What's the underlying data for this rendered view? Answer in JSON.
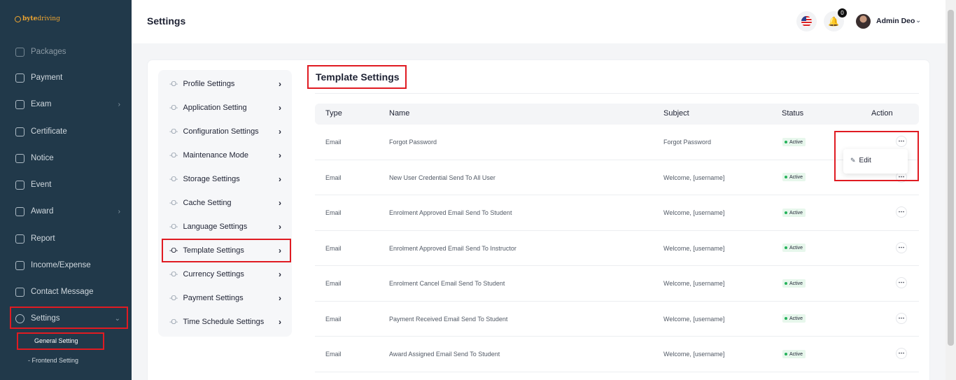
{
  "brand": {
    "part1": "byte",
    "part2": "driving"
  },
  "header": {
    "title": "Settings",
    "notification_count": "0",
    "user_name": "Admin Deo"
  },
  "sidebar": {
    "partial_item": "Packages",
    "items": [
      {
        "label": "Payment",
        "icon": "card-icon"
      },
      {
        "label": "Exam",
        "icon": "exam-icon",
        "has_chevron": true
      },
      {
        "label": "Certificate",
        "icon": "certificate-icon"
      },
      {
        "label": "Notice",
        "icon": "notice-icon"
      },
      {
        "label": "Event",
        "icon": "calendar-icon"
      },
      {
        "label": "Award",
        "icon": "award-icon",
        "has_chevron": true
      },
      {
        "label": "Report",
        "icon": "report-icon"
      },
      {
        "label": "Income/Expense",
        "icon": "wallet-icon"
      },
      {
        "label": "Contact Message",
        "icon": "message-icon"
      },
      {
        "label": "Settings",
        "icon": "gear-icon",
        "expanded": true
      }
    ],
    "subitems": [
      {
        "label": "General Setting",
        "active": true
      },
      {
        "label": "Frontend Setting"
      }
    ]
  },
  "settings_menu": [
    "Profile Settings",
    "Application Setting",
    "Configuration Settings",
    "Maintenance Mode",
    "Storage Settings",
    "Cache Setting",
    "Language Settings",
    "Template Settings",
    "Currency Settings",
    "Payment Settings",
    "Time Schedule Settings"
  ],
  "active_menu": "Template Settings",
  "template": {
    "title": "Template Settings",
    "columns": [
      "Type",
      "Name",
      "Subject",
      "Status",
      "Action"
    ],
    "rows": [
      {
        "type": "Email",
        "name": "Forgot Password",
        "subject": "Forgot Password",
        "status": "Active"
      },
      {
        "type": "Email",
        "name": "New User Credential Send To All User",
        "subject": "Welcome, [username]",
        "status": "Active"
      },
      {
        "type": "Email",
        "name": "Enrolment Approved Email Send To Student",
        "subject": "Welcome, [username]",
        "status": "Active"
      },
      {
        "type": "Email",
        "name": "Enrolment Approved Email Send To Instructor",
        "subject": "Welcome, [username]",
        "status": "Active"
      },
      {
        "type": "Email",
        "name": "Enrolment Cancel Email Send To Student",
        "subject": "Welcome, [username]",
        "status": "Active"
      },
      {
        "type": "Email",
        "name": "Payment Received Email Send To Student",
        "subject": "Welcome, [username]",
        "status": "Active"
      },
      {
        "type": "Email",
        "name": "Award Assigned Email Send To Student",
        "subject": "Welcome, [username]",
        "status": "Active"
      }
    ],
    "dropdown": {
      "edit_label": "Edit"
    }
  },
  "colors": {
    "sidebar_bg": "#21394a",
    "highlight": "#e01b22",
    "active_green": "#24b25a"
  }
}
